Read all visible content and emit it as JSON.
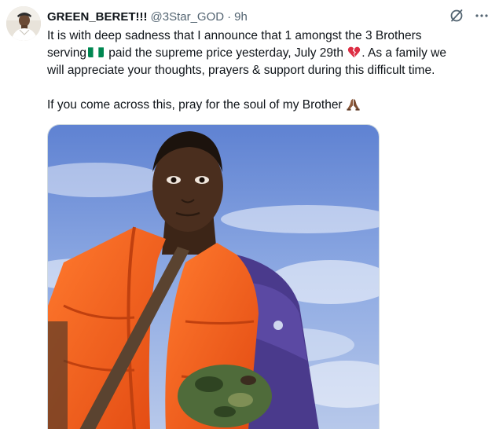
{
  "tweet": {
    "author": {
      "display_name": "GREEN_BERET!!!",
      "handle": "@3Star_GOD",
      "separator": "·",
      "time": "9h",
      "avatar_icon": "profile-avatar"
    },
    "text": {
      "line1": "It is with deep sadness that I announce that 1 amongst the 3 Brothers",
      "line2_a": "serving",
      "line2_b": " paid the supreme price yesterday, July 29th ",
      "line2_c": ". As a family we",
      "line3": "will appreciate your thoughts, prayers & support during this difficult time.",
      "line5": "If you come across this, pray for the soul of my Brother "
    },
    "emojis": {
      "flag": "nigeria-flag",
      "broken_heart": "broken-heart",
      "praying_hands": "praying-hands"
    },
    "actions": {
      "grok_icon": "grok-icon",
      "more_icon": "more-icon"
    },
    "media": {
      "description_icon": "photo"
    },
    "colors": {
      "text": "#0f1419",
      "secondary": "#536471",
      "flag_green": "#008751",
      "vest_orange": "#f05a1a",
      "sky_blue": "#7f9fdb"
    }
  }
}
